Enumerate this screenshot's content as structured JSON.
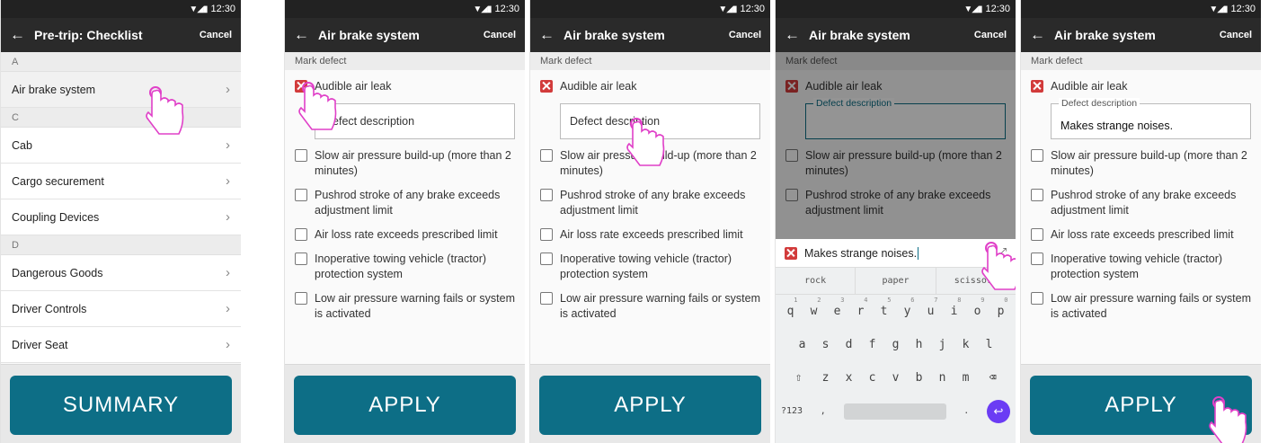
{
  "status": {
    "time": "12:30"
  },
  "checklist_screen": {
    "title": "Pre-trip: Checklist",
    "cancel": "Cancel",
    "sections": [
      {
        "letter": "A",
        "items": [
          "Air brake system"
        ]
      },
      {
        "letter": "C",
        "items": [
          "Cab",
          "Cargo securement",
          "Coupling Devices"
        ]
      },
      {
        "letter": "D",
        "items": [
          "Dangerous Goods",
          "Driver Controls",
          "Driver Seat"
        ]
      }
    ],
    "summary_button": "SUMMARY"
  },
  "brake_screen": {
    "title": "Air brake system",
    "cancel": "Cancel",
    "mark_defect": "Mark defect",
    "checked_item": "Audible air leak",
    "field_placeholder": "Defect description",
    "field_label": "Defect description",
    "field_value": "Makes strange noises.",
    "items": [
      "Slow air pressure build-up (more than 2 minutes)",
      "Pushrod stroke of any brake exceeds adjustment limit",
      "Air loss rate exceeds prescribed limit",
      "Inoperative towing vehicle (tractor) protection system",
      "Low air pressure warning fails or system is activated"
    ],
    "apply_button": "APPLY"
  },
  "keyboard": {
    "input_text": "Makes strange noises.",
    "suggestions": [
      "rock",
      "paper",
      "scissors"
    ],
    "row1": [
      "q",
      "w",
      "e",
      "r",
      "t",
      "y",
      "u",
      "i",
      "o",
      "p"
    ],
    "row1_numbers": [
      "1",
      "2",
      "3",
      "4",
      "5",
      "6",
      "7",
      "8",
      "9",
      "0"
    ],
    "row2": [
      "a",
      "s",
      "d",
      "f",
      "g",
      "h",
      "j",
      "k",
      "l"
    ],
    "row3": [
      "z",
      "x",
      "c",
      "v",
      "b",
      "n",
      "m"
    ],
    "shift": "⇧",
    "backspace": "⌫",
    "symbols": "?123",
    "comma": ",",
    "period": ".",
    "enter": "↩"
  },
  "colors": {
    "primary": "#0d6e86",
    "appbar": "#2a2a2a",
    "checked": "#d23b3b",
    "enter": "#6b3cf4",
    "hand": "#e040c8"
  }
}
